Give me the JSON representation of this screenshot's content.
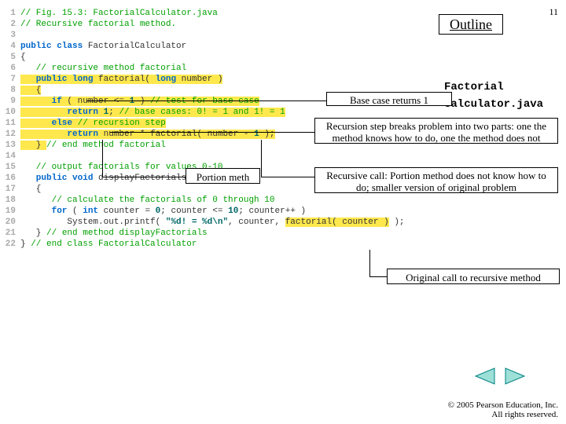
{
  "page_number": "11",
  "outline_label": "Outline",
  "filename_line1": "Factorial",
  "filename_line2": "Calculator.java",
  "code": {
    "l1_a": "// Fig. 15.3: FactorialCalculator.java",
    "l2_a": "// Recursive factorial method.",
    "l3_a": "",
    "l4_kw1": "public class",
    "l4_cls": " FactorialCalculator",
    "l5_a": "{",
    "l6_a": "   // recursive method factorial",
    "l7_kw": "   public long",
    "l7_rest": " factorial( ",
    "l7_kw2": "long",
    "l7_rest2": " number )",
    "l8_a": "   {",
    "l9_kw": "      if",
    "l9_rest": " ( number <= ",
    "l9_num": "1",
    "l9_rest2": " ) ",
    "l9_cmt": "// test for base case",
    "l10_kw": "         return",
    "l10_rest": " ",
    "l10_num": "1",
    "l10_rest2": "; ",
    "l10_cmt": "// base cases: 0! = 1 and 1! = 1",
    "l11_kw": "      else",
    "l11_cmt": " // recursion step",
    "l12_kw": "         return",
    "l12_rest": " number * factorial( number - ",
    "l12_num": "1",
    "l12_rest2": " );",
    "l13_a": "   } ",
    "l13_cmt": "// end method factorial",
    "l14_a": "",
    "l15_a": "   // output factorials for values 0-10",
    "l16_kw": "   public void",
    "l16_rest": " displayFactorials()",
    "l17_a": "   {",
    "l18_a": "      // calculate the factorials of 0 through 10",
    "l19_kw": "      for",
    "l19_rest": " ( ",
    "l19_kw2": "int",
    "l19_rest2": " counter = ",
    "l19_num1": "0",
    "l19_rest3": "; counter <= ",
    "l19_num2": "10",
    "l19_rest4": "; counter++ )",
    "l20_a": "         System.out.printf( ",
    "l20_str": "\"%d! = %d\\n\"",
    "l20_b": ", counter, ",
    "l20_call": "factorial( counter )",
    "l20_c": " );",
    "l21_a": "   } ",
    "l21_cmt": "// end method displayFactorials",
    "l22_a": "} ",
    "l22_cmt": "// end class FactorialCalculator"
  },
  "callouts": {
    "c1": "Base case returns 1",
    "c2": "Recursion step breaks problem into two parts: one the method knows how to do, one the method does not",
    "c3": "Portion meth",
    "c4": "Recursive call: Portion method does not know how to do; smaller version of original problem",
    "c5": "Original call to recursive method"
  },
  "copyright": "© 2005 Pearson Education, Inc.  All rights reserved."
}
